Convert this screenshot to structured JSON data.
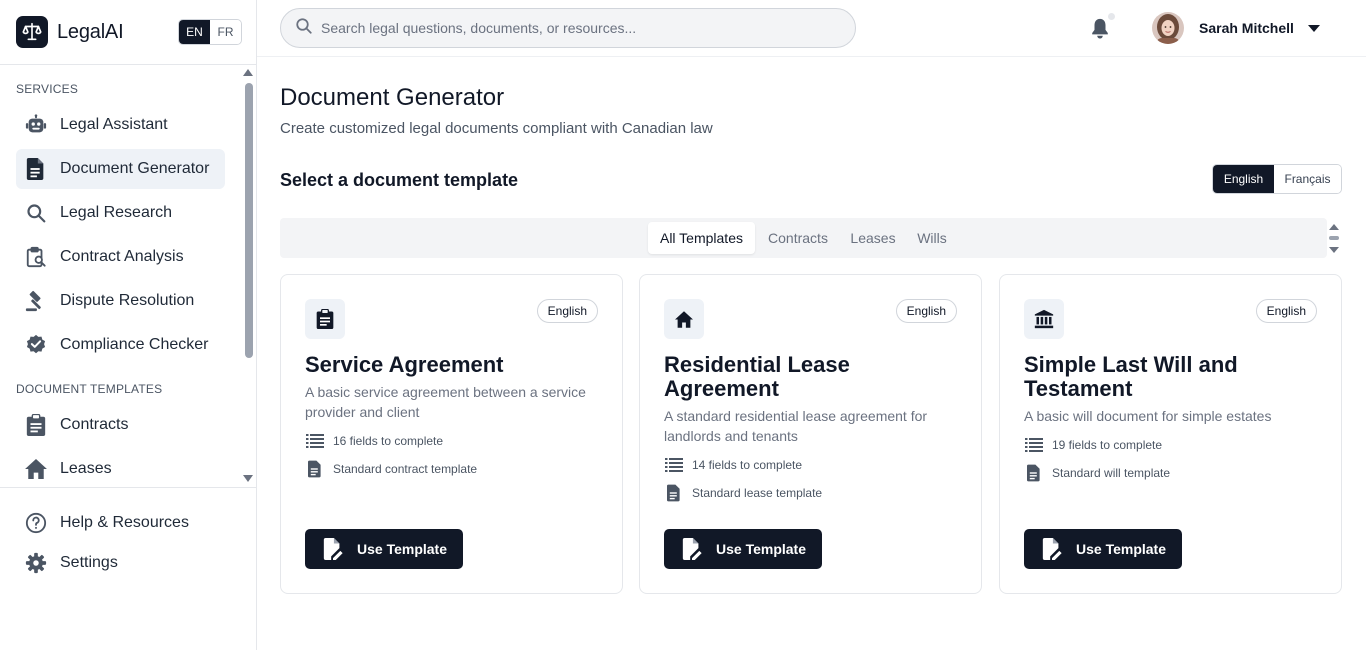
{
  "brand": {
    "name": "LegalAI"
  },
  "sidebar_lang": {
    "en": "EN",
    "fr": "FR",
    "active": "EN"
  },
  "sidebar": {
    "services_label": "SERVICES",
    "services": [
      {
        "label": "Legal Assistant",
        "icon": "robot-icon"
      },
      {
        "label": "Document Generator",
        "icon": "document-icon",
        "active": true
      },
      {
        "label": "Legal Research",
        "icon": "search-icon"
      },
      {
        "label": "Contract Analysis",
        "icon": "clipboard-search-icon"
      },
      {
        "label": "Dispute Resolution",
        "icon": "gavel-icon"
      },
      {
        "label": "Compliance Checker",
        "icon": "check-badge-icon"
      }
    ],
    "templates_label": "DOCUMENT TEMPLATES",
    "templates": [
      {
        "label": "Contracts",
        "icon": "clipboard-icon"
      },
      {
        "label": "Leases",
        "icon": "home-icon"
      }
    ],
    "footer": [
      {
        "label": "Help & Resources",
        "icon": "help-icon"
      },
      {
        "label": "Settings",
        "icon": "gear-icon"
      }
    ]
  },
  "header": {
    "search_placeholder": "Search legal questions, documents, or resources...",
    "user_name": "Sarah Mitchell"
  },
  "main": {
    "title": "Document Generator",
    "subtitle": "Create customized legal documents compliant with Canadian law",
    "section_heading": "Select a document template",
    "language_toggle": {
      "english": "English",
      "french": "Français",
      "active": "English"
    },
    "tabs": [
      {
        "label": "All Templates",
        "active": true
      },
      {
        "label": "Contracts"
      },
      {
        "label": "Leases"
      },
      {
        "label": "Wills"
      }
    ],
    "cards": [
      {
        "icon": "clipboard-icon",
        "badge": "English",
        "title": "Service Agreement",
        "description": "A basic service agreement between a service provider and client",
        "fields": "16 fields to complete",
        "type": "Standard contract template",
        "button": "Use Template"
      },
      {
        "icon": "home-icon",
        "badge": "English",
        "title": "Residential Lease Agreement",
        "description": "A standard residential lease agreement for landlords and tenants",
        "fields": "14 fields to complete",
        "type": "Standard lease template",
        "button": "Use Template"
      },
      {
        "icon": "bank-icon",
        "badge": "English",
        "title": "Simple Last Will and Testament",
        "description": "A basic will document for simple estates",
        "fields": "19 fields to complete",
        "type": "Standard will template",
        "button": "Use Template"
      }
    ]
  },
  "colors": {
    "primary": "#111827",
    "active_bg": "#eef2f7",
    "muted": "#6b7280"
  }
}
